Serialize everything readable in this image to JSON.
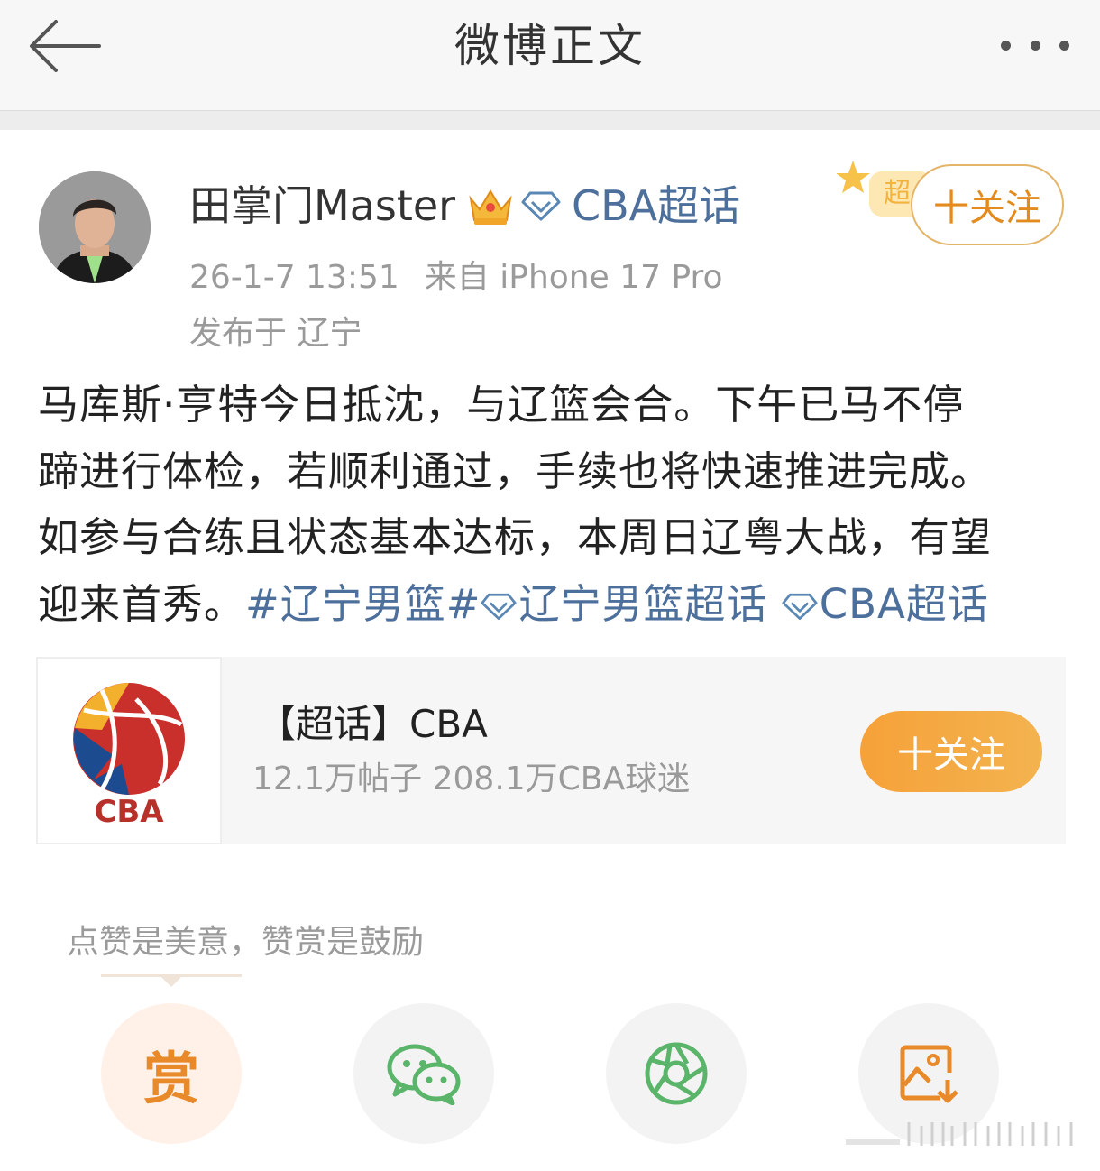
{
  "header": {
    "title": "微博正文",
    "back_icon": "arrow-left-icon",
    "more_icon": "more-dots-icon"
  },
  "post": {
    "author": "田掌门Master",
    "author_badge_icon": "crown-icon",
    "super_topic_link": "CBA超话",
    "timestamp": "26-1-7 13:51",
    "source": "来自 iPhone 17 Pro",
    "location": "发布于 辽宁",
    "follow_label": "十关注",
    "body_lines": [
      "马库斯·亨特今日抵沈，与辽篮会合。下午已马不停",
      "蹄进行体检，若顺利通过，手续也将快速推进完成。",
      "如参与合练且状态基本达标，本周日辽粤大战，有望",
      "迎来首秀。"
    ],
    "hashtag": "#辽宁男篮#",
    "topic_link_1": "辽宁男篮超话",
    "topic_link_2": "CBA超话"
  },
  "topic_card": {
    "title": "【超话】CBA",
    "stats": "12.1万帖子 208.1万CBA球迷",
    "follow_label": "十关注",
    "logo_text": "CBA"
  },
  "reward": {
    "hint": "点赞是美意，赞赏是鼓励",
    "reward_glyph": "赏",
    "actions": [
      "reward-icon",
      "wechat-icon",
      "moments-icon",
      "save-image-icon"
    ]
  },
  "colors": {
    "link": "#4d6f9b",
    "accent_orange": "#e48b1f",
    "muted": "#9a9a9a",
    "wechat_green": "#5ab46a",
    "reward_orange": "#e88a2a"
  }
}
